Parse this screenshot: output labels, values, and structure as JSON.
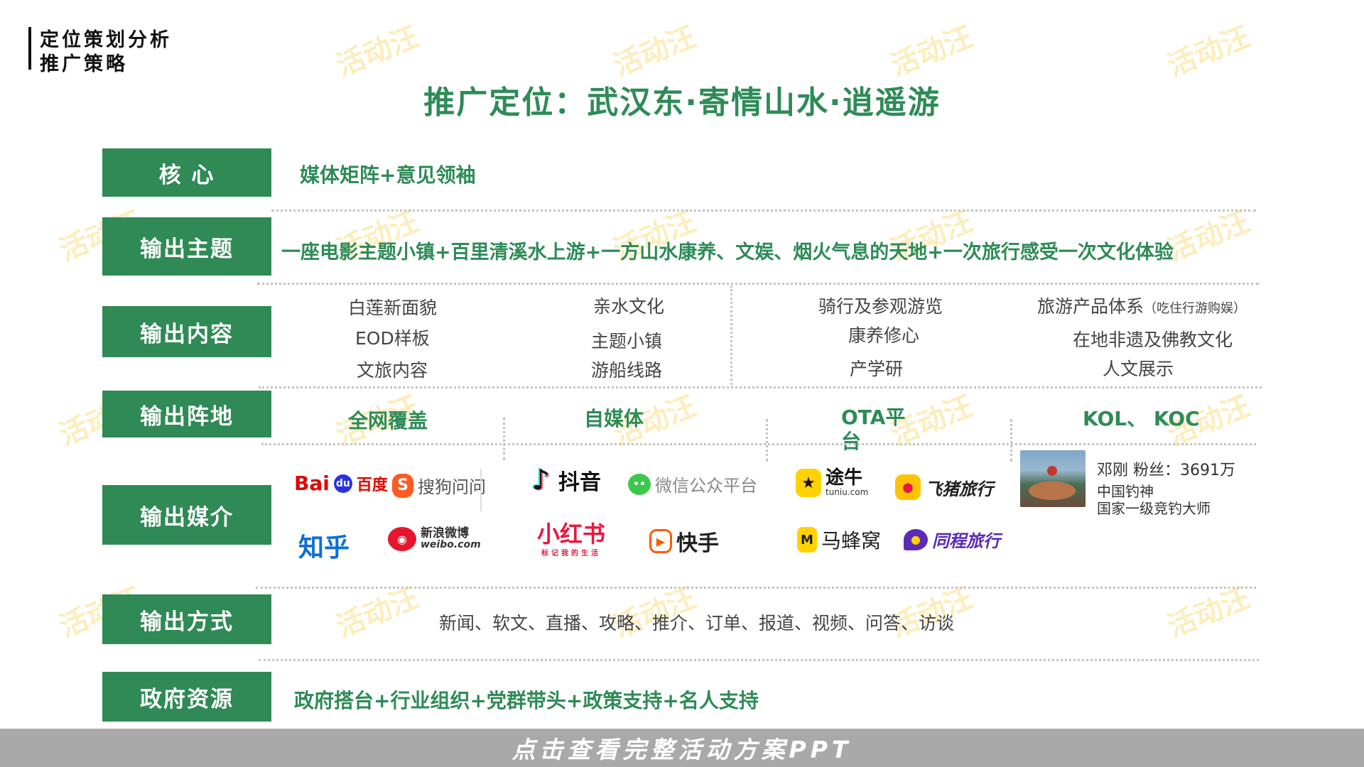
{
  "header": {
    "line1": "定位策划分析",
    "line2": "推广策略"
  },
  "title": "推广定位：武汉东·寄情山水·逍遥游",
  "rows": {
    "core": {
      "label": "核 心",
      "text": "媒体矩阵+意见领袖"
    },
    "theme": {
      "label": "输出主题",
      "text": "一座电影主题小镇+百里清溪水上游+一方山水康养、文娱、烟火气息的天地+一次旅行感受一次文化体验"
    },
    "content": {
      "label": "输出内容",
      "items": [
        "白莲新面貌",
        "EOD样板",
        "文旅内容",
        "亲水文化",
        "主题小镇",
        "游船线路",
        "骑行及参观游览",
        "康养修心",
        "产学研",
        "旅游产品体系",
        "在地非遗及佛教文化",
        "人文展示"
      ],
      "note": "（吃住行游购娱）"
    },
    "base": {
      "label": "输出阵地",
      "cols": [
        "全网覆盖",
        "自媒体",
        "OTA平台",
        "KOL、 KOC"
      ]
    },
    "media": {
      "label": "输出媒介",
      "logos": {
        "baidu_a": "Bai",
        "baidu_b": "百度",
        "sogou": "搜狗问问",
        "zhihu": "知乎",
        "weibo_cn": "新浪微博",
        "weibo_en": "weibo.com",
        "douyin": "抖音",
        "wechat": "微信公众平台",
        "xhs": "小红书",
        "xhs_sub": "标记我的生活",
        "kuaishou": "快手",
        "tuniu": "途牛",
        "tuniu_sub": "tuniu.com",
        "fliggy": "飞猪旅行",
        "mafengwo": "马蜂窝",
        "tongcheng": "同程旅行"
      },
      "kol": {
        "name_fans": "邓刚 粉丝：3691万",
        "title1": "中国钓神",
        "title2": "国家一级竞钓大师"
      }
    },
    "method": {
      "label": "输出方式",
      "text": "新闻、软文、直播、攻略、推介、订单、报道、视频、问答、访谈"
    },
    "gov": {
      "label": "政府资源",
      "text": "政府搭台+行业组织+党群带头+政策支持+名人支持"
    }
  },
  "watermark": "活动汪",
  "footer": "点击查看完整活动方案PPT",
  "colors": {
    "green": "#2f8a55",
    "title_green": "#2e8b57",
    "footer_gray": "#a9a9a9",
    "watermark": "#fbe8a6"
  }
}
